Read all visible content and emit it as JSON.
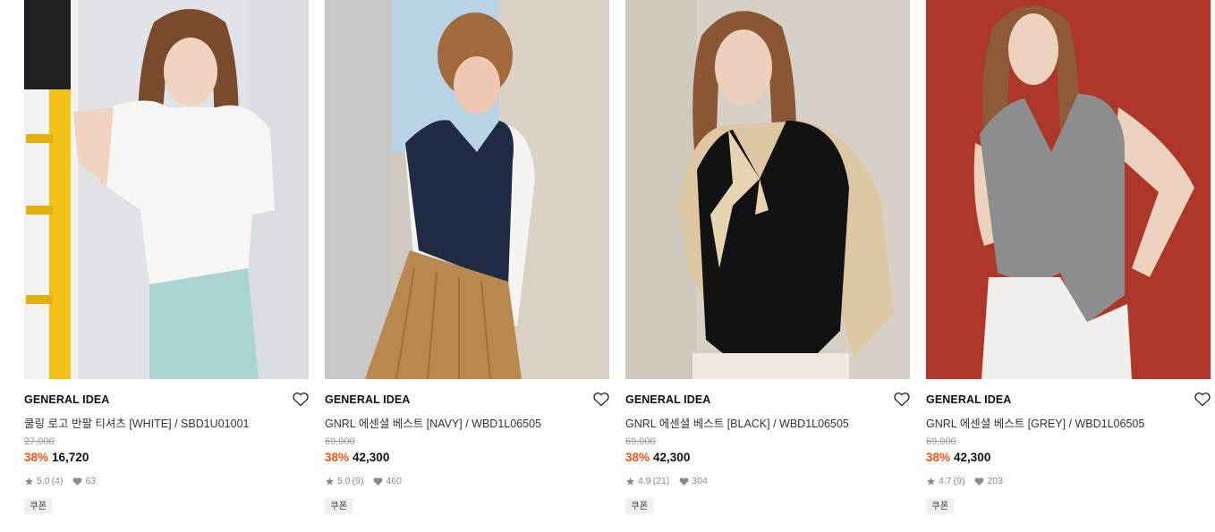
{
  "products": [
    {
      "brand": "GENERAL IDEA",
      "title": "쿨링 로고 반팔 티셔츠 [WHITE] / SBD1U01001",
      "original_price": "27,000",
      "discount": "38%",
      "price": "16,720",
      "rating": "5.0",
      "review_count": "(4)",
      "likes": "63",
      "badge": "쿠폰",
      "image_icon": "product-photo-white-tshirt"
    },
    {
      "brand": "GENERAL IDEA",
      "title": "GNRL 에센셜 베스트 [NAVY] / WBD1L06505",
      "original_price": "69,000",
      "discount": "38%",
      "price": "42,300",
      "rating": "5.0",
      "review_count": "(9)",
      "likes": "460",
      "badge": "쿠폰",
      "image_icon": "product-photo-navy-vest"
    },
    {
      "brand": "GENERAL IDEA",
      "title": "GNRL 에센셜 베스트 [BLACK] / WBD1L06505",
      "original_price": "69,000",
      "discount": "38%",
      "price": "42,300",
      "rating": "4.9",
      "review_count": "(21)",
      "likes": "304",
      "badge": "쿠폰",
      "image_icon": "product-photo-black-vest"
    },
    {
      "brand": "GENERAL IDEA",
      "title": "GNRL 에센셜 베스트 [GREY] / WBD1L06505",
      "original_price": "69,000",
      "discount": "38%",
      "price": "42,300",
      "rating": "4.7",
      "review_count": "(9)",
      "likes": "203",
      "badge": "쿠폰",
      "image_icon": "product-photo-grey-vest"
    }
  ],
  "colors": {
    "discount": "#f35314",
    "meta": "#8a8a8a",
    "badge_bg": "#f1f1f1"
  }
}
